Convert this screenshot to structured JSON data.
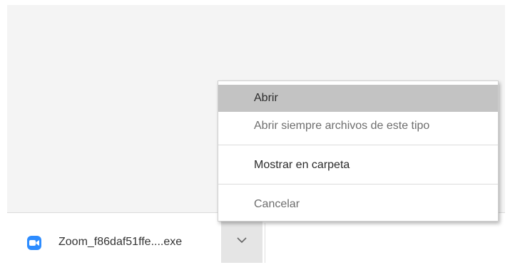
{
  "download_shelf": {
    "file_name": "Zoom_f86daf51ffe....exe",
    "file_icon": "zoom-app-icon",
    "dropdown_icon": "chevron-down-icon"
  },
  "context_menu": {
    "items": [
      {
        "label": "Abrir",
        "state": "highlighted"
      },
      {
        "label": "Abrir siempre archivos de este tipo",
        "state": "normal"
      },
      {
        "label": "Mostrar en carpeta",
        "state": "normal"
      },
      {
        "label": "Cancelar",
        "state": "normal"
      }
    ]
  },
  "colors": {
    "zoom_blue": "#2d8cff",
    "highlight": "#c3c3c3",
    "content_background": "#f4f4f4"
  }
}
